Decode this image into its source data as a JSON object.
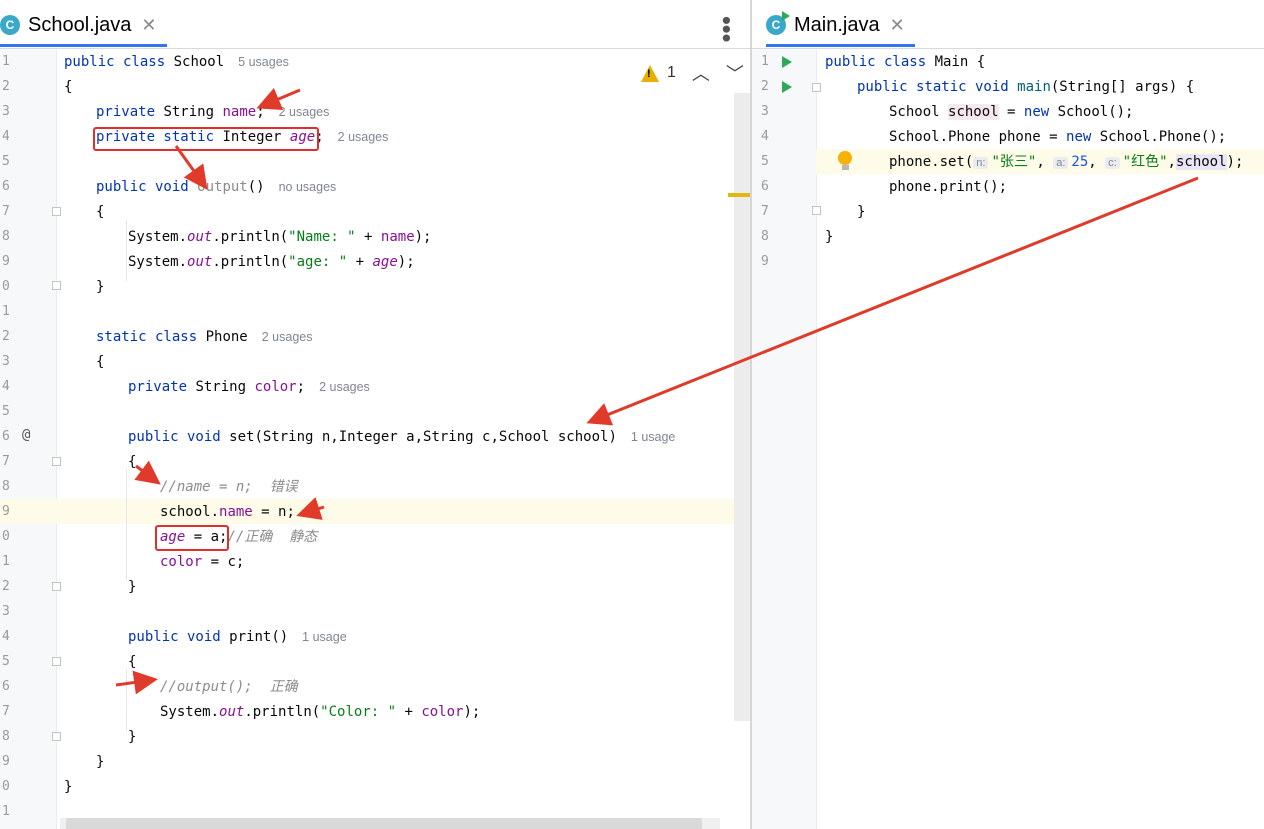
{
  "left_tab": {
    "icon": "C",
    "name": "School.java",
    "close": "✕"
  },
  "right_tab": {
    "icon": "C",
    "name": "Main.java",
    "close": "✕"
  },
  "warnings": {
    "count": "1",
    "up": "︿",
    "down": "﹀"
  },
  "left_lines": [
    "1",
    "2",
    "3",
    "4",
    "5",
    "6",
    "7",
    "8",
    "9",
    "0",
    "1",
    "2",
    "3",
    "4",
    "5",
    "6",
    "7",
    "8",
    "9",
    "0",
    "1",
    "2",
    "3",
    "4",
    "5",
    "6",
    "7",
    "8",
    "9",
    "0",
    "1"
  ],
  "right_lines": [
    "1",
    "2",
    "3",
    "4",
    "5",
    "6",
    "7",
    "8",
    "9"
  ],
  "gutter_at": "@",
  "school": {
    "l1": {
      "kw": "public class",
      "name": "School",
      "hint": "5 usages"
    },
    "l2": "{",
    "l3": {
      "kw": "private",
      "type": "String",
      "field": "name",
      "semi": ";",
      "hint": "2 usages"
    },
    "l4": {
      "kw": "private static",
      "type": "Integer",
      "field": "age",
      "semi": ";",
      "hint": "2 usages"
    },
    "l6": {
      "kw": "public void",
      "method": "output",
      "parens": "()",
      "hint": "no usages"
    },
    "l7": "{",
    "l8": {
      "pre": "System.",
      "out": "out",
      "mid": ".println(",
      "str": "\"Name: \"",
      "plus": " + ",
      "field": "name",
      "end": ");"
    },
    "l9": {
      "pre": "System.",
      "out": "out",
      "mid": ".println(",
      "str": "\"age: \"",
      "plus": " + ",
      "field": "age",
      "end": ");"
    },
    "l10": "}",
    "l12": {
      "kw": "static class",
      "name": "Phone",
      "hint": "2 usages"
    },
    "l13": "{",
    "l14": {
      "kw": "private",
      "type": "String",
      "field": "color",
      "semi": ";",
      "hint": "2 usages"
    },
    "l16": {
      "kw": "public void",
      "sig": "set(String n,Integer a,String c,School school)",
      "hint": "1 usage"
    },
    "l17": "{",
    "l18": {
      "comment": "//name = n;  错误"
    },
    "l19": {
      "pre": "school.",
      "field": "name",
      "rest": " = n;"
    },
    "l20": {
      "field": "age",
      "rest": " = a;",
      "comment": "//正确  静态"
    },
    "l21": {
      "field": "color",
      "rest": " = c;"
    },
    "l22": "}",
    "l24": {
      "kw": "public void",
      "method": "print",
      "parens": "()",
      "hint": "1 usage"
    },
    "l25": "{",
    "l26": {
      "comment": "//output();  正确"
    },
    "l27": {
      "pre": "System.",
      "out": "out",
      "mid": ".println(",
      "str": "\"Color: \"",
      "plus": " + ",
      "field": "color",
      "end": ");"
    },
    "l28": "}",
    "l29": "}",
    "l30": "}"
  },
  "main": {
    "l1": {
      "kw": "public class",
      "name": "Main {"
    },
    "l2": {
      "kw1": "public static void",
      "method": "main",
      "rest": "(String[] args) {"
    },
    "l3": {
      "type": "School ",
      "var": "school",
      "eq": " = ",
      "kw": "new",
      "rest": " School();"
    },
    "l4": {
      "type": "School.Phone phone = ",
      "kw": "new",
      "rest": " School.Phone();"
    },
    "l5": {
      "pre": "phone.set(",
      "p1": "n:",
      "s1": "\"张三\"",
      "c1": ", ",
      "p2": "a:",
      "n2": "25",
      "c2": ", ",
      "p3": "c:",
      "s3": "\"红色\"",
      "c3": ",",
      "v4": "school",
      "end": ");"
    },
    "l6": "phone.print();",
    "l7": "}",
    "l8": "}"
  }
}
